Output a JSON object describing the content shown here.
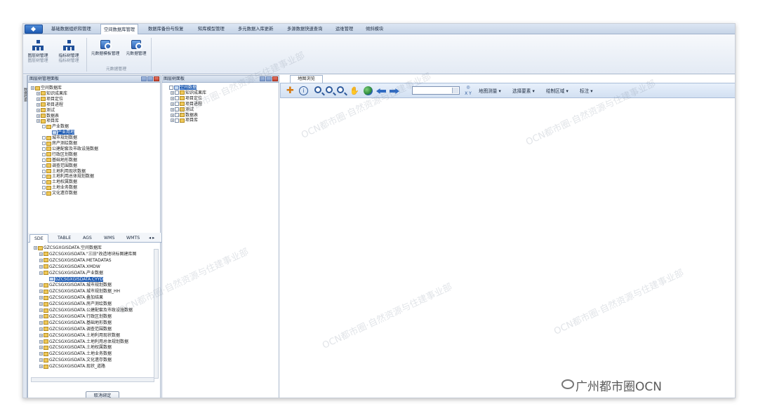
{
  "menu": {
    "tabs": [
      {
        "label": "基础数据组织和管理"
      },
      {
        "label": "空间数据库管理"
      },
      {
        "label": "数据库备份与恢复"
      },
      {
        "label": "知库模型管理"
      },
      {
        "label": "多元数据入库更新"
      },
      {
        "label": "多源数据快速查询"
      },
      {
        "label": "运维管理"
      },
      {
        "label": "倾斜模块"
      }
    ]
  },
  "ribbon": {
    "buttons": [
      {
        "label1": "图层树管理",
        "label2": "图层树管理"
      },
      {
        "label1": "指标树管理",
        "label2": "指标树管理"
      },
      {
        "label1": "元数据模板管理",
        "label2": ""
      },
      {
        "label1": "元数据管理",
        "label2": ""
      }
    ],
    "group_caption": "元数据管理"
  },
  "side_strip": {
    "label": "数据检索"
  },
  "left_panel": {
    "title": "图层树管理面板",
    "tree": [
      {
        "label": "空间数据库",
        "level": 0,
        "selected": false
      },
      {
        "label": "知识成果库",
        "level": 1,
        "selected": false
      },
      {
        "label": "项目定位",
        "level": 1,
        "selected": false
      },
      {
        "label": "项目进程",
        "level": 1,
        "selected": false
      },
      {
        "label": "测试",
        "level": 1,
        "selected": false
      },
      {
        "label": "数据表",
        "level": 1,
        "selected": false
      },
      {
        "label": "项目库",
        "level": 1,
        "selected": false
      },
      {
        "label": "产业数据",
        "level": 2,
        "selected": false
      },
      {
        "label": "产业用地",
        "level": 3,
        "selected": true
      },
      {
        "label": "城市规划数据",
        "level": 2,
        "selected": false
      },
      {
        "label": "房产测绘数据",
        "level": 2,
        "selected": false
      },
      {
        "label": "公建配套及市政设施数据",
        "level": 2,
        "selected": false
      },
      {
        "label": "行政区划数据",
        "level": 2,
        "selected": false
      },
      {
        "label": "基础地形数据",
        "level": 2,
        "selected": false
      },
      {
        "label": "调查范围数据",
        "level": 2,
        "selected": false
      },
      {
        "label": "土地利用现状数据",
        "level": 2,
        "selected": false
      },
      {
        "label": "土地利用总体规划数据",
        "level": 2,
        "selected": false
      },
      {
        "label": "土地权属数据",
        "level": 2,
        "selected": false
      },
      {
        "label": "土地业务数据",
        "level": 2,
        "selected": false
      },
      {
        "label": "文化遗存数据",
        "level": 2,
        "selected": false
      }
    ],
    "source_tabs": [
      {
        "label": "SDE"
      },
      {
        "label": "TABLE"
      },
      {
        "label": "AGS"
      },
      {
        "label": "WMS"
      },
      {
        "label": "WMTS"
      }
    ],
    "sde_tree": [
      {
        "label": "GZCSGXGISDATA.空间数据库",
        "level": 0,
        "selected": false
      },
      {
        "label": "GZCSGXGISDATA.\"三旧\"改造地块标图建库图",
        "level": 1,
        "selected": false
      },
      {
        "label": "GZCSGXGISDATA.METADATAS",
        "level": 1,
        "selected": false
      },
      {
        "label": "GZCSGXGISDATA.XMDW",
        "level": 1,
        "selected": false
      },
      {
        "label": "GZCSGXGISDATA.产业数据",
        "level": 1,
        "selected": false
      },
      {
        "label": "GZCSGXGISDATA.CYYD",
        "level": 2,
        "selected": true
      },
      {
        "label": "GZCSGXGISDATA.城市规划数据",
        "level": 1,
        "selected": false
      },
      {
        "label": "GZCSGXGISDATA.城市规划数据_HH",
        "level": 1,
        "selected": false
      },
      {
        "label": "GZCSGXGISDATA.叠加结果",
        "level": 1,
        "selected": false
      },
      {
        "label": "GZCSGXGISDATA.房产测绘数据",
        "level": 1,
        "selected": false
      },
      {
        "label": "GZCSGXGISDATA.公建配套及市政设施数据",
        "level": 1,
        "selected": false
      },
      {
        "label": "GZCSGXGISDATA.行政区划数据",
        "level": 1,
        "selected": false
      },
      {
        "label": "GZCSGXGISDATA.基础地形数据",
        "level": 1,
        "selected": false
      },
      {
        "label": "GZCSGXGISDATA.调查范围数据",
        "level": 1,
        "selected": false
      },
      {
        "label": "GZCSGXGISDATA.土地利用现状数据",
        "level": 1,
        "selected": false
      },
      {
        "label": "GZCSGXGISDATA.土地利用总体规划数据",
        "level": 1,
        "selected": false
      },
      {
        "label": "GZCSGXGISDATA.土地权属数据",
        "level": 1,
        "selected": false
      },
      {
        "label": "GZCSGXGISDATA.土地业务数据",
        "level": 1,
        "selected": false
      },
      {
        "label": "GZCSGXGISDATA.文化遗存数据",
        "level": 1,
        "selected": false
      },
      {
        "label": "GZCSGXGISDATA.现状_道路",
        "level": 1,
        "selected": false
      }
    ],
    "unbind_button": "取消绑定"
  },
  "mid_panel": {
    "title": "图层树面板",
    "tree": [
      {
        "label": "空间数据",
        "level": 0,
        "selected": true
      },
      {
        "label": "知识成果库",
        "level": 1,
        "selected": false
      },
      {
        "label": "项目定位",
        "level": 1,
        "selected": false
      },
      {
        "label": "项目进程",
        "level": 1,
        "selected": false
      },
      {
        "label": "测试",
        "level": 1,
        "selected": false
      },
      {
        "label": "数据表",
        "level": 1,
        "selected": false
      },
      {
        "label": "项目库",
        "level": 1,
        "selected": false
      }
    ]
  },
  "map": {
    "tab": "地图浏览",
    "toolbar": {
      "combo_value": "",
      "xy_label": "X Y",
      "measure": "地图测量",
      "select": "选择要素",
      "draw": "绘制区域",
      "annotate": "标注"
    }
  },
  "watermark": {
    "text1": "OCN都市圈·自然资源与住建事业部",
    "brand": "广州都市圈OCN"
  }
}
